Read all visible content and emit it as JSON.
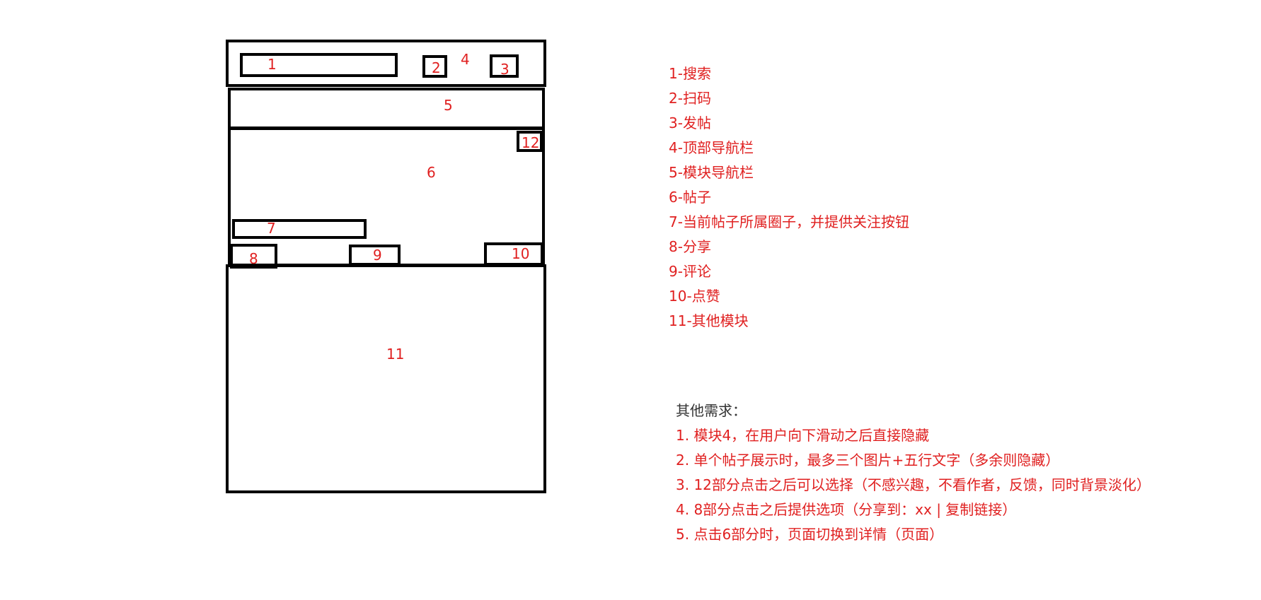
{
  "wireframe": {
    "labels": {
      "search": "1",
      "scan": "2",
      "top_nav": "4",
      "post_button": "3",
      "module_nav": "5",
      "post": "6",
      "more_menu": "12",
      "circle_follow": "7",
      "share": "8",
      "comment": "9",
      "like": "10",
      "other_modules": "11"
    }
  },
  "legend": {
    "items": [
      "1-搜索",
      "2-扫码",
      "3-发帖",
      "4-顶部导航栏",
      "5-模块导航栏",
      "6-帖子",
      "7-当前帖子所属圈子，并提供关注按钮",
      "8-分享",
      "9-评论",
      "10-点赞",
      "11-其他模块"
    ]
  },
  "requirements": {
    "title": "其他需求：",
    "lines": [
      "1. 模块4，在用户向下滑动之后直接隐藏",
      "2. 单个帖子展示时，最多三个图片+五行文字（多余则隐藏）",
      "3. 12部分点击之后可以选择（不感兴趣，不看作者，反馈，同时背景淡化）",
      "4. 8部分点击之后提供选项（分享到：xx | 复制链接）",
      "5. 点击6部分时，页面切换到详情（页面）"
    ]
  },
  "colors": {
    "annotation": "#e02020",
    "outline": "#000000",
    "heading": "#333333"
  }
}
